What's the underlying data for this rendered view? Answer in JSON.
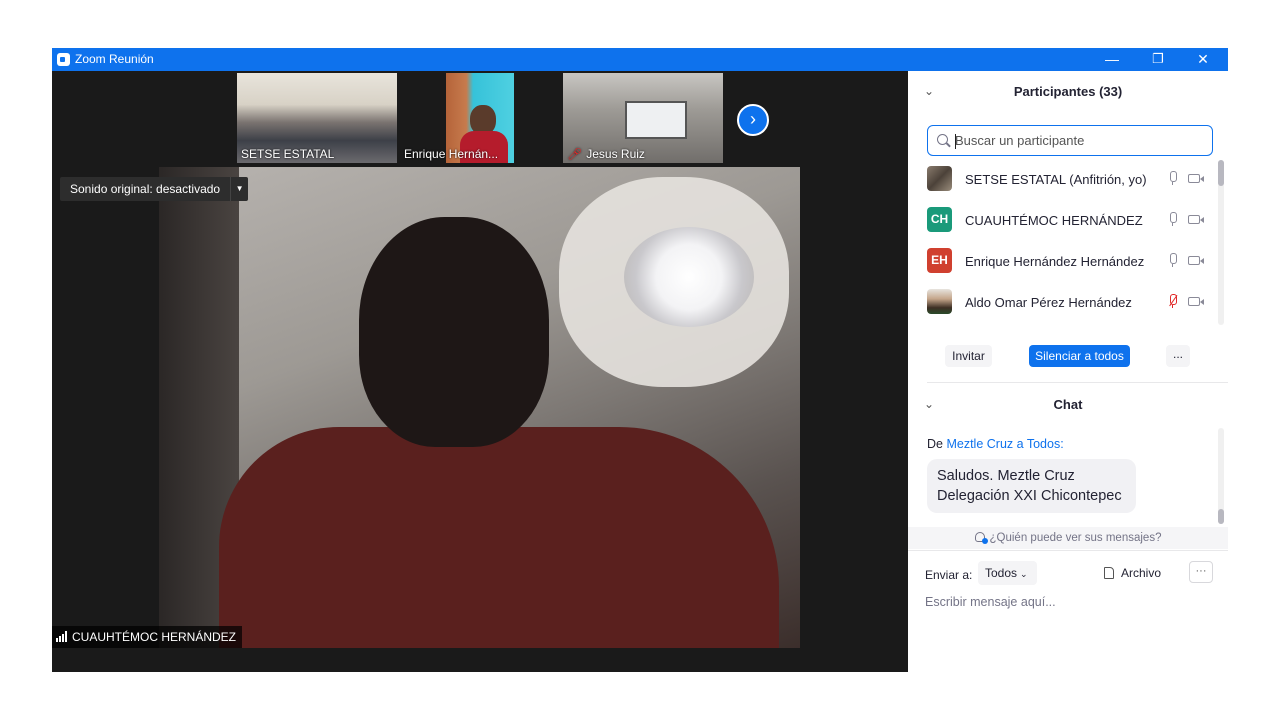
{
  "window": {
    "title": "Zoom Reunión",
    "controls": {
      "minimize": "—",
      "restore": "❐",
      "close": "✕"
    }
  },
  "thumbnails": [
    {
      "name": "SETSE ESTATAL",
      "muted": false
    },
    {
      "name": "Enrique Hernán...",
      "muted": false
    },
    {
      "name": "Jesus Ruiz",
      "muted": true
    }
  ],
  "next_arrow": "›",
  "sound_chip": {
    "label": "Sonido original: desactivado",
    "arrow": "▼"
  },
  "active_speaker": {
    "name": "CUAUHTÉMOC HERNÁNDEZ"
  },
  "participants": {
    "header": "Participantes (33)",
    "search_placeholder": "Buscar un participante",
    "items": [
      {
        "name": "SETSE ESTATAL (Anfitrión, yo)",
        "avatar_text": "",
        "avatar_color": "#6b5f55",
        "mic_muted": false
      },
      {
        "name": "CUAUHTÉMOC HERNÁNDEZ",
        "avatar_text": "CH",
        "avatar_color": "#1a9a7a",
        "mic_muted": false
      },
      {
        "name": "Enrique Hernández Hernández",
        "avatar_text": "EH",
        "avatar_color": "#d0402f",
        "mic_muted": false
      },
      {
        "name": "Aldo Omar Pérez Hernández",
        "avatar_text": "",
        "avatar_color": "#5a4a3a",
        "mic_muted": true
      }
    ],
    "buttons": {
      "invite": "Invitar",
      "mute_all": "Silenciar a todos",
      "more": "..."
    }
  },
  "chat": {
    "header": "Chat",
    "message": {
      "prefix": "De",
      "sender": "Meztle Cruz",
      "connector": "a",
      "recipient": "Todos:",
      "line1": "Saludos. Meztle Cruz",
      "line2": "Delegación XXI Chicontepec"
    },
    "who_can_see": "¿Quién puede ver sus mensajes?",
    "send_to_label": "Enviar a:",
    "send_to_value": "Todos",
    "file_label": "Archivo",
    "more": "···",
    "input_placeholder": "Escribir mensaje aquí..."
  },
  "colors": {
    "accent": "#0e72ed",
    "danger": "#e02828"
  }
}
